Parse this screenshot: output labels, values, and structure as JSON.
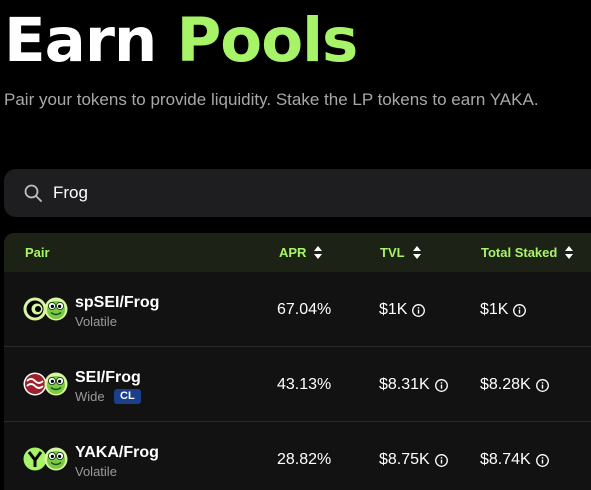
{
  "header": {
    "title_word1": "Earn",
    "title_word2": "Pools",
    "subtitle": "Pair your tokens to provide liquidity. Stake the LP tokens to earn YAKA."
  },
  "search": {
    "value": "Frog",
    "icon": "search-icon"
  },
  "table": {
    "columns": [
      "Pair",
      "APR",
      "TVL",
      "Total Staked"
    ],
    "rows": [
      {
        "pair": "spSEI/Frog",
        "type": "Volatile",
        "badge": "",
        "apr": "67.04%",
        "tvl": "$1K",
        "staked": "$1K",
        "logos": [
          "spsei-token-icon",
          "frog-token-icon"
        ]
      },
      {
        "pair": "SEI/Frog",
        "type": "Wide",
        "badge": "CL",
        "apr": "43.13%",
        "tvl": "$8.31K",
        "staked": "$8.28K",
        "logos": [
          "sei-token-icon",
          "frog-token-icon"
        ]
      },
      {
        "pair": "YAKA/Frog",
        "type": "Volatile",
        "badge": "",
        "apr": "28.82%",
        "tvl": "$8.75K",
        "staked": "$8.74K",
        "logos": [
          "yaka-token-icon",
          "frog-token-icon"
        ]
      }
    ]
  },
  "colors": {
    "accent": "#a8f468",
    "background": "#000000",
    "header_row": "#1d2216",
    "badge_bg": "#1b3f8a"
  }
}
